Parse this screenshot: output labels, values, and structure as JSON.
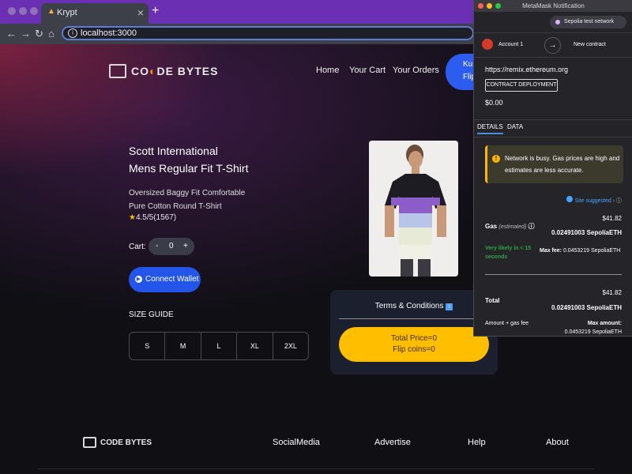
{
  "browser": {
    "tab_title": "Krypt",
    "tab_close": "×",
    "new_tab": "+",
    "url": "localhost:3000",
    "nav_icons": [
      "back-icon",
      "forward-icon",
      "reload-icon",
      "home-icon"
    ]
  },
  "site": {
    "logo_text_1": "CO",
    "logo_text_2": "DE BYTES",
    "nav": [
      "Home",
      "Your Cart",
      "Your Orders"
    ],
    "kunt_button": {
      "line1": "Kun",
      "line2": "Flip"
    },
    "product": {
      "title_line1": "Scott International",
      "title_line2": "Mens Regular Fit T-Shirt",
      "description": "Oversized Baggy Fit Comfortable Pure Cotton Round T-Shirt",
      "rating": "4.5/5(1567)"
    },
    "cart": {
      "label": "Cart:",
      "minus": "-",
      "qty": "0",
      "plus": "+"
    },
    "connect_wallet": "Connect Wallet",
    "size_guide": "SIZE GUIDE",
    "sizes": [
      "S",
      "M",
      "L",
      "XL",
      "2XL"
    ],
    "terms": "Terms & Conditions",
    "total_price": "Total Price=0",
    "flip_coins": "Flip coins=0",
    "footer": {
      "logo": "CODE BYTES",
      "links": [
        "SocialMedia",
        "Advertise",
        "Help",
        "About"
      ]
    },
    "colors": {
      "accent_blue": "#2356e8",
      "cta_yellow": "#ffbf00",
      "brand_purple": "#6b2fb3"
    }
  },
  "metamask": {
    "window_title": "MetaMask Notification",
    "network": "Sepolia test network",
    "account": "Account 1",
    "new_contract": "New contract",
    "origin": "https://remix.ethereum.org",
    "action": "CONTRACT DEPLOYMENT",
    "amount": "$0.00",
    "tabs": [
      "DETAILS",
      "DATA"
    ],
    "warning": "Network is busy. Gas prices are high and estimates are less accurate.",
    "site_suggested": "Site suggested",
    "gas": {
      "label": "Gas",
      "estimated": "(estimated)",
      "usd": "$41.82",
      "eth": "0.02491003 SepoliaETH",
      "likely": "Very likely in < 15 seconds",
      "max_fee_label": "Max fee:",
      "max_fee": "0.0453219 SepoliaETH"
    },
    "total": {
      "label": "Total",
      "usd": "$41.82",
      "eth": "0.02491003 SepoliaETH",
      "amount_gas": "Amount + gas fee",
      "max_amount_label": "Max amount:",
      "max_amount": "0.0453219 SepoliaETH"
    }
  }
}
